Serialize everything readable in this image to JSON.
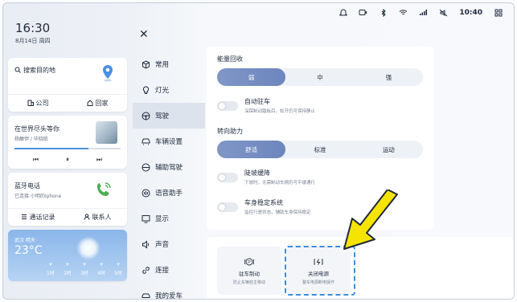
{
  "status": {
    "time": "10:40",
    "icons": [
      "notification-icon",
      "camera-icon",
      "bluetooth-icon",
      "wifi-icon",
      "signal-icon",
      "no-sound-icon"
    ]
  },
  "home": {
    "clock": "16:30",
    "date": "8月14日 周四",
    "nav": {
      "search": "搜索目的地",
      "company": "公司",
      "home": "回家"
    },
    "music": {
      "song": "在世界尽头等你",
      "artist": "杨馥伊 / 毕晓航",
      "progress": 0.7
    },
    "phone": {
      "title": "蓝牙电话",
      "subtitle": "已连接 小明的iphone",
      "call_log": "通话记录",
      "contacts": "联系人"
    },
    "weather": {
      "city": "武汉 晴天",
      "temp": "23°C",
      "forecast": [
        "1时",
        "2时",
        "3时",
        "4时",
        "5时"
      ]
    }
  },
  "sidebar": {
    "items": [
      {
        "label": "常用",
        "icon": "cube-icon"
      },
      {
        "label": "灯光",
        "icon": "bulb-icon"
      },
      {
        "label": "驾驶",
        "icon": "steering-icon"
      },
      {
        "label": "车辆设置",
        "icon": "car-icon"
      },
      {
        "label": "辅助驾驶",
        "icon": "assist-icon"
      },
      {
        "label": "语音助手",
        "icon": "voice-icon"
      },
      {
        "label": "显示",
        "icon": "display-icon"
      },
      {
        "label": "声音",
        "icon": "speaker-icon"
      },
      {
        "label": "连接",
        "icon": "link-icon"
      },
      {
        "label": "我的爱车",
        "icon": "mycar-icon"
      }
    ],
    "active_index": 2
  },
  "settings": {
    "energy": {
      "label": "能量回收",
      "options": [
        "弱",
        "中",
        "强"
      ],
      "selected": 0
    },
    "auto_hold": {
      "title": "自动驻车",
      "desc": "深踩制动踏板后，松开仍可保持静止"
    },
    "steering": {
      "label": "转向助力",
      "options": [
        "舒适",
        "标准",
        "运动"
      ],
      "selected": 0
    },
    "hill": {
      "title": "陡坡缓降",
      "desc": "下坡时，无需制动车辆仍可平缓通行"
    },
    "stability": {
      "title": "车身稳定系统",
      "desc": "监控行驶状态，辅助车身保持稳定"
    }
  },
  "bottom_cards": [
    {
      "title": "驻车制动",
      "desc": "防止车辆自主移动",
      "icon": "parking-brake-icon"
    },
    {
      "title": "关闭电源",
      "desc": "整车电源断电操作",
      "icon": "power-off-icon"
    }
  ],
  "colors": {
    "accent": "#6d86bd",
    "highlight_border": "#3d8de0",
    "arrow": "#f5e400"
  }
}
